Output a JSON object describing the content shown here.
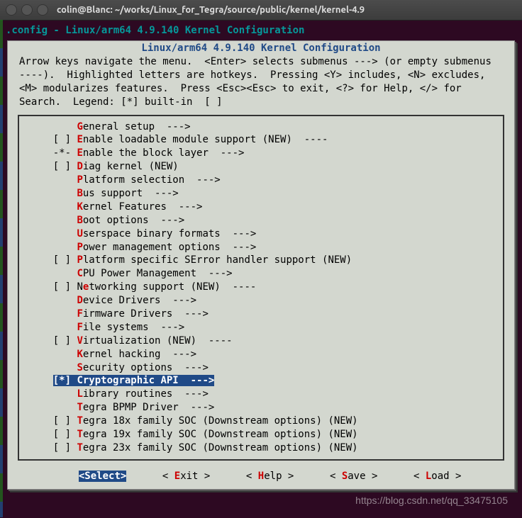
{
  "window": {
    "title": "colin@Blanc: ~/works/Linux_for_Tegra/source/public/kernel/kernel-4.9"
  },
  "config_header": ".config - Linux/arm64 4.9.140 Kernel Configuration",
  "box_title": "Linux/arm64 4.9.140 Kernel Configuration",
  "help_text": "Arrow keys navigate the menu.  <Enter> selects submenus ---> (or empty submenus ----).  Highlighted letters are hotkeys.  Pressing <Y> includes, <N> excludes, <M> modularizes features.  Press <Esc><Esc> to exit, <?> for Help, </> for Search.  Legend: [*] built-in  [ ]",
  "menu": [
    {
      "prefix": "    ",
      "hot": "G",
      "rest": "eneral setup  --->"
    },
    {
      "prefix": "[ ] ",
      "hot": "E",
      "rest": "nable loadable module support (NEW)  ----"
    },
    {
      "prefix": "-*- ",
      "hot": "E",
      "rest": "nable the block layer  --->"
    },
    {
      "prefix": "[ ] ",
      "hot": "D",
      "rest": "iag kernel (NEW)"
    },
    {
      "prefix": "    ",
      "hot": "P",
      "rest": "latform selection  --->"
    },
    {
      "prefix": "    ",
      "hot": "B",
      "rest": "us support  --->"
    },
    {
      "prefix": "    ",
      "hot": "K",
      "rest": "ernel Features  --->"
    },
    {
      "prefix": "    ",
      "hot": "B",
      "rest": "oot options  --->"
    },
    {
      "prefix": "    ",
      "hot": "U",
      "rest": "serspace binary formats  --->"
    },
    {
      "prefix": "    ",
      "hot": "P",
      "rest": "ower management options  --->"
    },
    {
      "prefix": "[ ] ",
      "hot": "P",
      "rest": "latform specific SError handler support (NEW)"
    },
    {
      "prefix": "    ",
      "hot": "C",
      "rest": "PU Power Management  --->"
    },
    {
      "prefix": "[ ] ",
      "hot": "N",
      "pre": "e",
      "rest": "tworking support (NEW)  ----"
    },
    {
      "prefix": "    ",
      "hot": "D",
      "rest": "evice Drivers  --->"
    },
    {
      "prefix": "    ",
      "hot": "F",
      "rest": "irmware Drivers  --->"
    },
    {
      "prefix": "    ",
      "hot": "F",
      "rest": "ile systems  --->"
    },
    {
      "prefix": "[ ] ",
      "hot": "V",
      "rest": "irtualization (NEW)  ----"
    },
    {
      "prefix": "    ",
      "hot": "K",
      "rest": "ernel hacking  --->"
    },
    {
      "prefix": "    ",
      "hot": "S",
      "rest": "ecurity options  --->"
    },
    {
      "prefix": "[*] ",
      "hot": "C",
      "rest": "ryptographic API  --->",
      "selected": true
    },
    {
      "prefix": "    ",
      "hot": "L",
      "rest": "ibrary routines  --->"
    },
    {
      "prefix": "    ",
      "hot": "T",
      "rest": "egra BPMP Driver  --->"
    },
    {
      "prefix": "[ ] ",
      "hot": "T",
      "rest": "egra 18x family SOC (Downstream options) (NEW)"
    },
    {
      "prefix": "[ ] ",
      "hot": "T",
      "rest": "egra 19x family SOC (Downstream options) (NEW)"
    },
    {
      "prefix": "[ ] ",
      "hot": "T",
      "rest": "egra 23x family SOC (Downstream options) (NEW)"
    }
  ],
  "buttons": {
    "select": {
      "open": "<",
      "hot": "S",
      "rest": "elect>",
      "selected": true
    },
    "exit": {
      "open": "< ",
      "hot": "E",
      "rest": "xit >"
    },
    "help": {
      "open": "< ",
      "hot": "H",
      "rest": "elp >"
    },
    "save": {
      "open": "< ",
      "hot": "S",
      "rest": "ave >"
    },
    "load": {
      "open": "< ",
      "hot": "L",
      "rest": "oad >"
    }
  },
  "watermark": "https://blog.csdn.net/qq_33475105"
}
